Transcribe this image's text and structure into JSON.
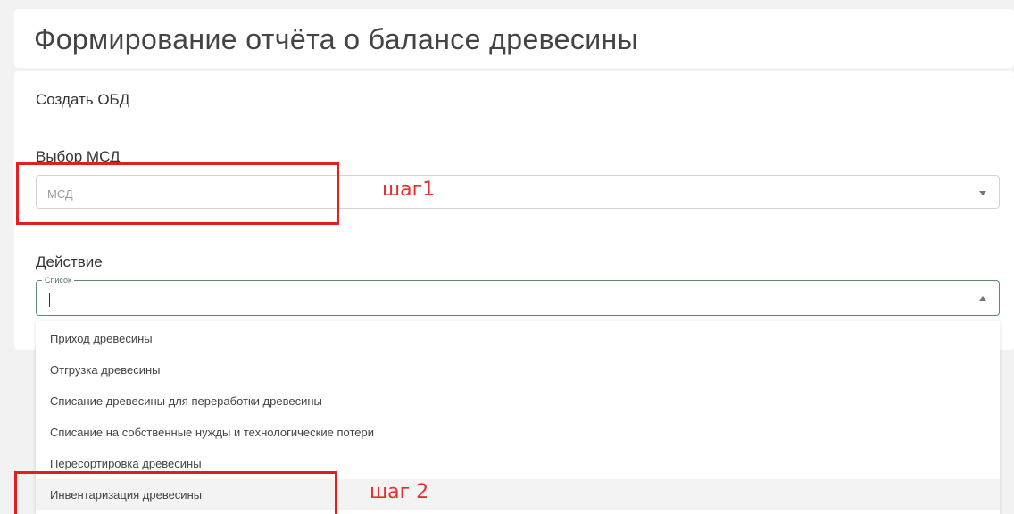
{
  "page": {
    "title": "Формирование отчёта о балансе древесины"
  },
  "form": {
    "section_title": "Создать ОБД",
    "msd_label": "Выбор МСД",
    "msd_placeholder": "МСД",
    "action_label": "Действие",
    "action_legend": "Список",
    "action_value": ""
  },
  "dropdown": {
    "items": [
      "Приход древесины",
      "Отгрузка древесины",
      "Списание древесины для переработки древесины",
      "Списание на собственные нужды и технологические потери",
      "Пересортировка древесины",
      "Инвентаризация древесины"
    ]
  },
  "annotations": {
    "step1": "шаг1",
    "step2": "шаг 2"
  },
  "colors": {
    "highlight": "#e02020",
    "focus_border": "#5a8a70"
  }
}
